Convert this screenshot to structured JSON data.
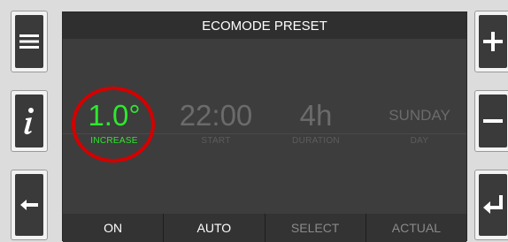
{
  "screen": {
    "title": "ECOMODE PRESET",
    "params": [
      {
        "value": "1.0°",
        "label": "INCREASE",
        "color": "#2ee82e"
      },
      {
        "value": "22:00",
        "label": "START"
      },
      {
        "value": "4h",
        "label": "DURATION"
      },
      {
        "value": "SUNDAY",
        "label": "DAY"
      }
    ],
    "selection_ring_color": "#d40000"
  },
  "softkeys": [
    "ON",
    "AUTO",
    "SELECT",
    "ACTUAL"
  ],
  "side_buttons": {
    "left": [
      {
        "icon": "menu-icon"
      },
      {
        "icon": "info-icon"
      },
      {
        "icon": "back-arrow-icon"
      }
    ],
    "right": [
      {
        "icon": "plus-icon"
      },
      {
        "icon": "minus-icon"
      },
      {
        "icon": "enter-icon"
      }
    ]
  }
}
